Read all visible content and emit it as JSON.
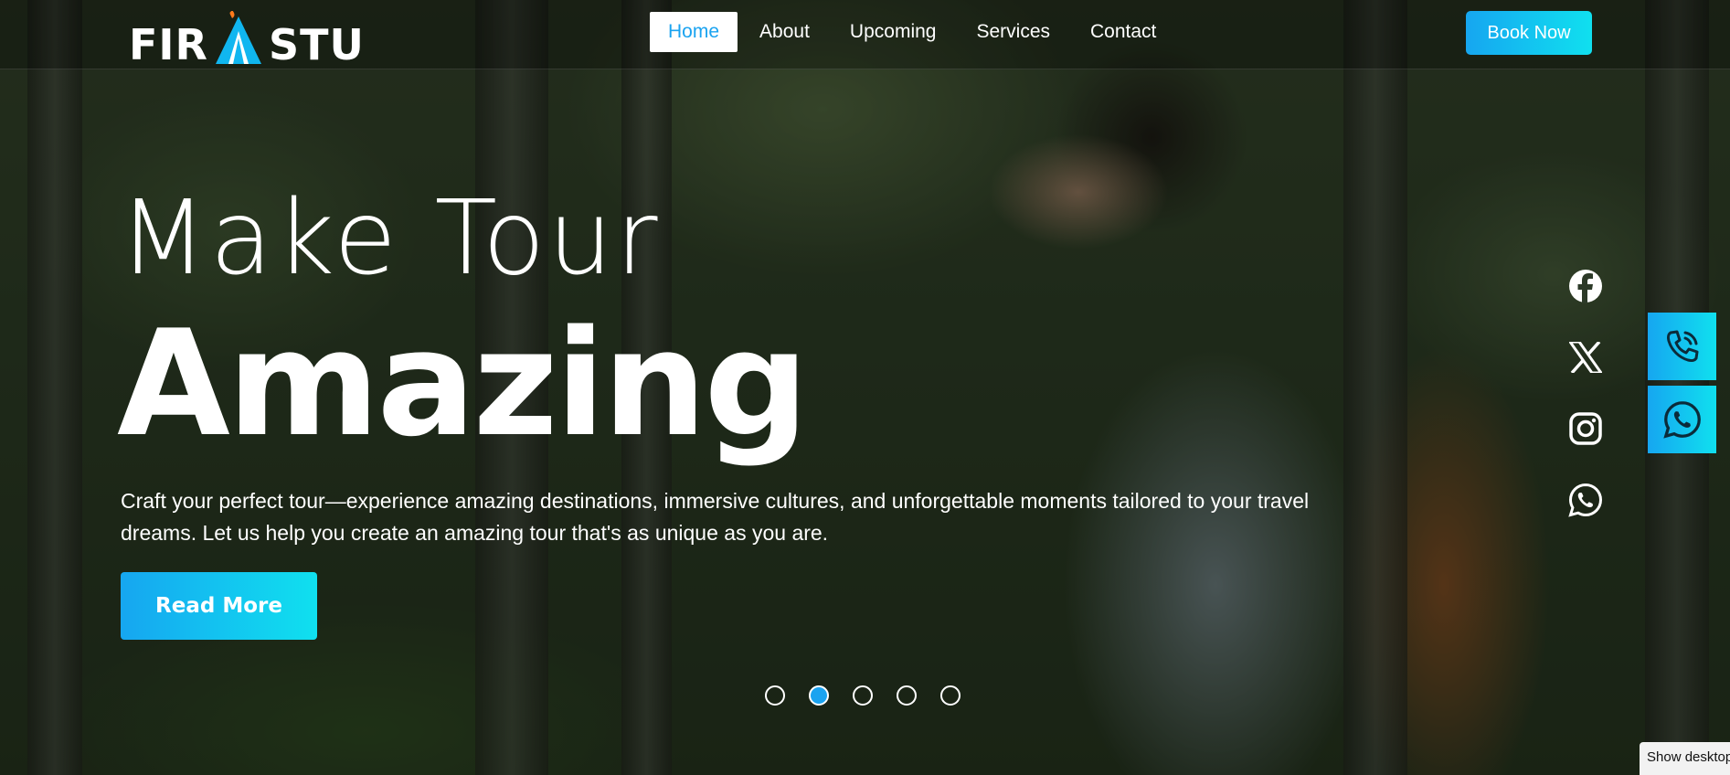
{
  "header": {
    "logo_left": "FIR",
    "logo_right": "STU",
    "nav": [
      "Home",
      "About",
      "Upcoming",
      "Services",
      "Contact"
    ],
    "active_nav": "Home",
    "book_label": "Book Now"
  },
  "hero": {
    "line1": "Make Tour",
    "line2": "Amazing",
    "description": "Craft your perfect tour—experience amazing destinations, immersive cultures, and unforgettable moments tailored to your travel dreams. Let us help you create an amazing tour that's as unique as you are.",
    "button_label": "Read More"
  },
  "slider": {
    "count": 5,
    "active_index": 2
  },
  "social": [
    "facebook-icon",
    "x-icon",
    "instagram-icon",
    "whatsapp-icon"
  ],
  "floating": [
    "phone-icon",
    "whatsapp-icon"
  ],
  "system": {
    "show_desktop": "Show desktop"
  },
  "colors": {
    "accent_start": "#16a6f0",
    "accent_end": "#10e0ef",
    "text": "#ffffff"
  }
}
